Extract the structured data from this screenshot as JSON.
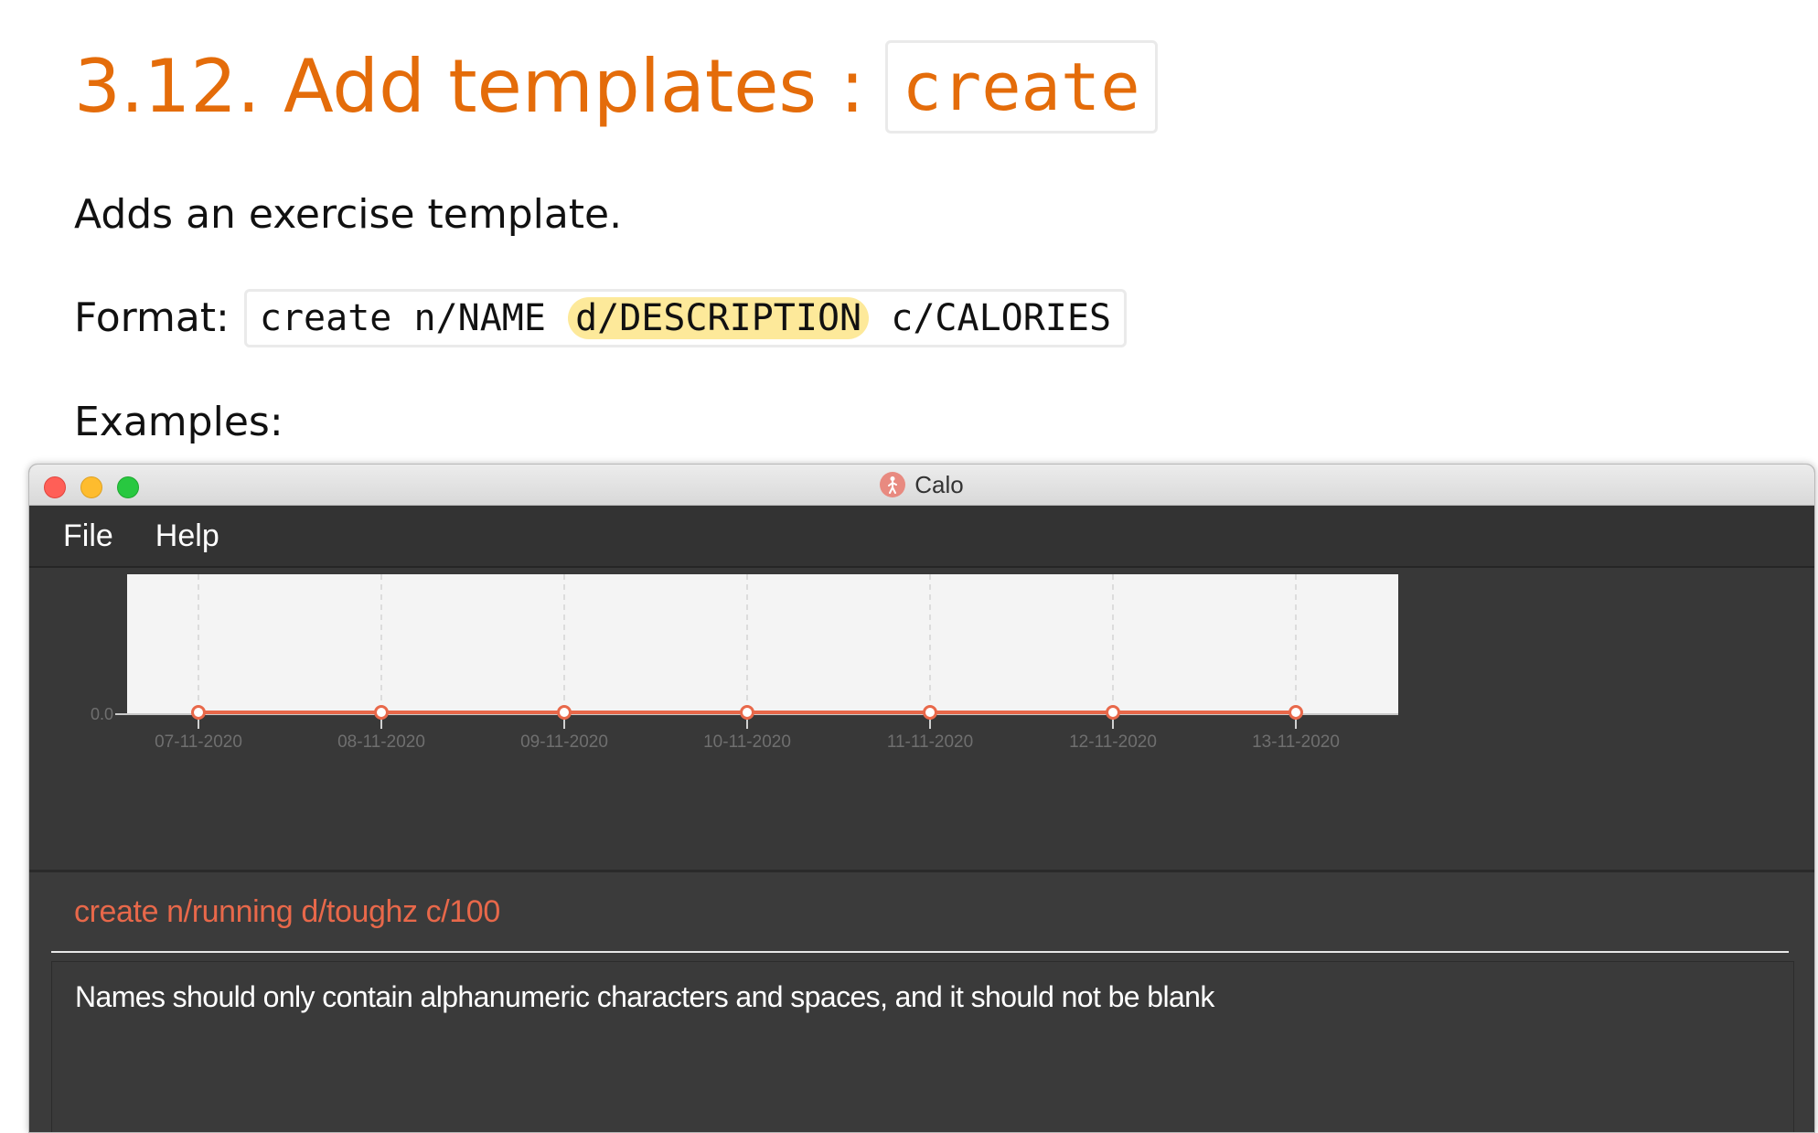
{
  "doc": {
    "heading_text": "3.12. Add templates :",
    "heading_command": "create",
    "description": "Adds an exercise template.",
    "format_label": "Format:",
    "format_part1": "create n/NAME",
    "format_part2": "d/DESCRIPTION",
    "format_part3": "c/CALORIES",
    "examples_label": "Examples:"
  },
  "window": {
    "title": "Calo",
    "menu": [
      "File",
      "Help"
    ]
  },
  "chart_data": {
    "type": "line",
    "x": [
      "07-11-2020",
      "08-11-2020",
      "09-11-2020",
      "10-11-2020",
      "11-11-2020",
      "12-11-2020",
      "13-11-2020"
    ],
    "series": [
      {
        "values": [
          0,
          0,
          0,
          0,
          0,
          0,
          0
        ]
      }
    ],
    "y_ticks": [
      "0.0"
    ],
    "ylim": [
      0,
      1
    ],
    "grid": true,
    "colors": {
      "line": "#e8684a",
      "plot_bg": "#f4f4f4",
      "tick_label": "#6f6f6f"
    }
  },
  "command": {
    "value": "create n/running d/toughz c/100",
    "color": "#e8684a"
  },
  "result": {
    "message": "Names should only contain alphanumeric characters and spaces, and it should not be blank"
  }
}
